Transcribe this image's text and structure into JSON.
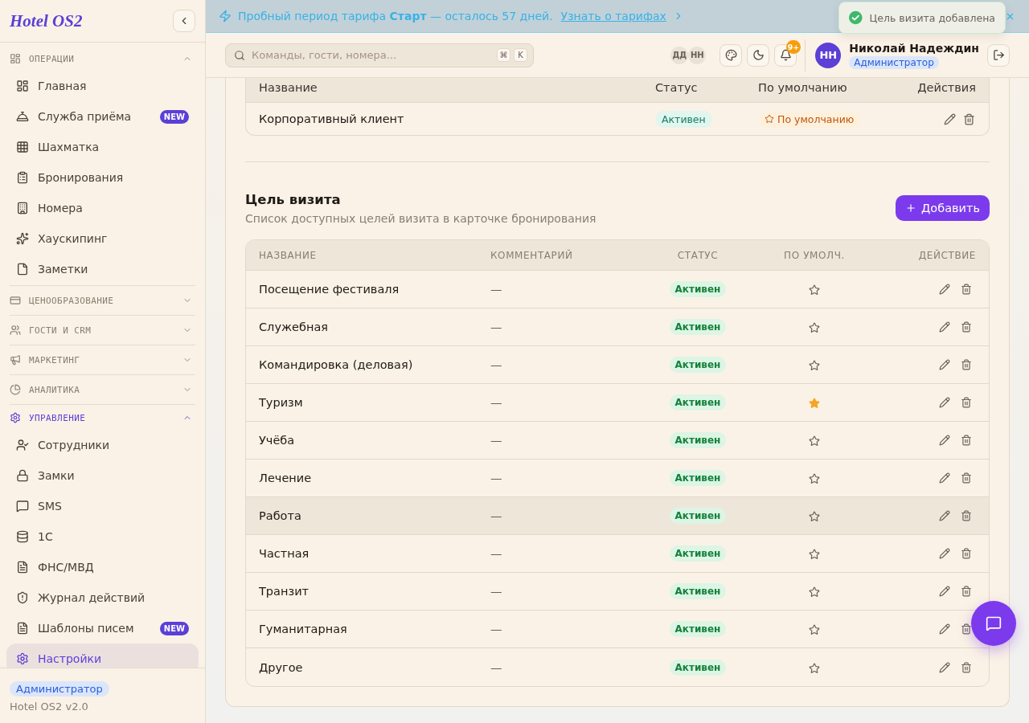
{
  "banner": {
    "text": "Пробный период тарифа **Старт** — осталось 57 дней.",
    "link": "Узнать о тарифах"
  },
  "toast": {
    "text": "Цель визита добавлена"
  },
  "sidebar": {
    "logo": "Hotel OS2",
    "sections": [
      {
        "title": "ОПЕРАЦИИ",
        "expanded": true,
        "active": false,
        "items": [
          {
            "label": "Главная",
            "selected": false
          },
          {
            "label": "Служба приёма",
            "badge": "NEW",
            "selected": false
          },
          {
            "label": "Шахматка",
            "selected": false
          },
          {
            "label": "Бронирования",
            "selected": false
          },
          {
            "label": "Номера",
            "selected": false
          },
          {
            "label": "Хаускипинг",
            "selected": false
          },
          {
            "label": "Заметки",
            "selected": false
          }
        ]
      },
      {
        "title": "ЦЕНООБРАЗОВАНИЕ",
        "expanded": false,
        "active": false
      },
      {
        "title": "ГОСТИ И CRM",
        "expanded": false,
        "active": false
      },
      {
        "title": "МАРКЕТИНГ",
        "expanded": false,
        "active": false
      },
      {
        "title": "АНАЛИТИКА",
        "expanded": false,
        "active": false
      },
      {
        "title": "УПРАВЛЕНИЕ",
        "expanded": true,
        "active": true,
        "items": [
          {
            "label": "Сотрудники",
            "selected": false
          },
          {
            "label": "Замки",
            "selected": false
          },
          {
            "label": "SMS",
            "selected": false
          },
          {
            "label": "1С",
            "selected": false
          },
          {
            "label": "ФНС/МВД",
            "selected": false
          },
          {
            "label": "Журнал действий",
            "selected": false
          },
          {
            "label": "Шаблоны писем",
            "badge": "NEW",
            "selected": false
          },
          {
            "label": "Настройки",
            "selected": true
          }
        ]
      }
    ],
    "footer": {
      "role": "Администратор",
      "version": "Hotel OS2 v2.0"
    }
  },
  "topbar": {
    "search": {
      "placeholder": "Команды, гости, номера...",
      "shortcut": [
        "⌘",
        "K"
      ]
    },
    "presence": [
      "ДД",
      "НН"
    ],
    "notifications_badge": "9+",
    "user": {
      "initials": "НН",
      "name": "Николай Надеждин",
      "role": "Администратор"
    }
  },
  "segments_table": {
    "columns": [
      "Название",
      "Статус",
      "По умолчанию",
      "Действия"
    ],
    "rows": [
      {
        "name": "Корпоративный клиент",
        "status": "Активен",
        "default_badge": "По умолчанию"
      }
    ]
  },
  "visit_purposes": {
    "title": "Цель визита",
    "subtitle": "Список доступных целей визита в карточке бронирования",
    "add_button": "Добавить",
    "table": {
      "columns": [
        "НАЗВАНИЕ",
        "КОММЕНТАРИЙ",
        "СТАТУС",
        "ПО УМОЛЧ.",
        "ДЕЙСТВИЕ"
      ],
      "rows": [
        {
          "name": "Посещение фестиваля",
          "comment": "—",
          "status": "Активен",
          "default": false,
          "highlighted": false
        },
        {
          "name": "Служебная",
          "comment": "—",
          "status": "Активен",
          "default": false,
          "highlighted": false
        },
        {
          "name": "Командировка (деловая)",
          "comment": "—",
          "status": "Активен",
          "default": false,
          "highlighted": false
        },
        {
          "name": "Туризм",
          "comment": "—",
          "status": "Активен",
          "default": true,
          "highlighted": false
        },
        {
          "name": "Учёба",
          "comment": "—",
          "status": "Активен",
          "default": false,
          "highlighted": false
        },
        {
          "name": "Лечение",
          "comment": "—",
          "status": "Активен",
          "default": false,
          "highlighted": false
        },
        {
          "name": "Работа",
          "comment": "—",
          "status": "Активен",
          "default": false,
          "highlighted": true
        },
        {
          "name": "Частная",
          "comment": "—",
          "status": "Активен",
          "default": false,
          "highlighted": false
        },
        {
          "name": "Транзит",
          "comment": "—",
          "status": "Активен",
          "default": false,
          "highlighted": false
        },
        {
          "name": "Гуманитарная",
          "comment": "—",
          "status": "Активен",
          "default": false,
          "highlighted": false
        },
        {
          "name": "Другое",
          "comment": "—",
          "status": "Активен",
          "default": false,
          "highlighted": false
        }
      ]
    }
  }
}
